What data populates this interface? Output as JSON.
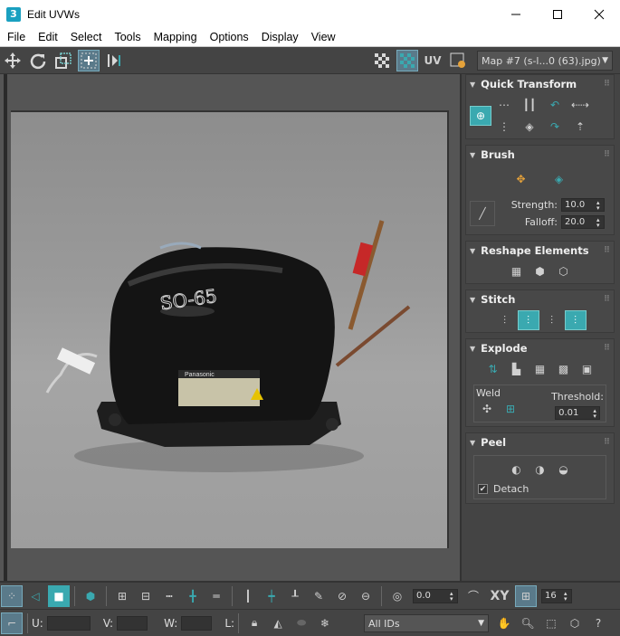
{
  "window": {
    "title": "Edit UVWs",
    "icon_text": "3"
  },
  "menu": [
    "File",
    "Edit",
    "Select",
    "Tools",
    "Mapping",
    "Options",
    "Display",
    "View"
  ],
  "toolbar": {
    "uv_label": "UV",
    "map_select": "Map #7 (s-l...0 (63).jpg)"
  },
  "rollouts": {
    "quick_transform": "Quick Transform",
    "brush": "Brush",
    "brush_strength_label": "Strength:",
    "brush_strength": "10.0",
    "brush_falloff_label": "Falloff:",
    "brush_falloff": "20.0",
    "reshape": "Reshape Elements",
    "stitch": "Stitch",
    "explode": "Explode",
    "weld_label": "Weld",
    "threshold_label": "Threshold:",
    "threshold": "0.01",
    "peel": "Peel",
    "detach_label": "Detach"
  },
  "bottom": {
    "spin_value": "0.0",
    "xy_label": "XY",
    "grid_count": "16",
    "u_label": "U:",
    "v_label": "V:",
    "w_label": "W:",
    "l_label": "L:",
    "ids_select": "All IDs"
  },
  "photo_text": {
    "brand": "Panasonic",
    "hand": "SO-65"
  }
}
